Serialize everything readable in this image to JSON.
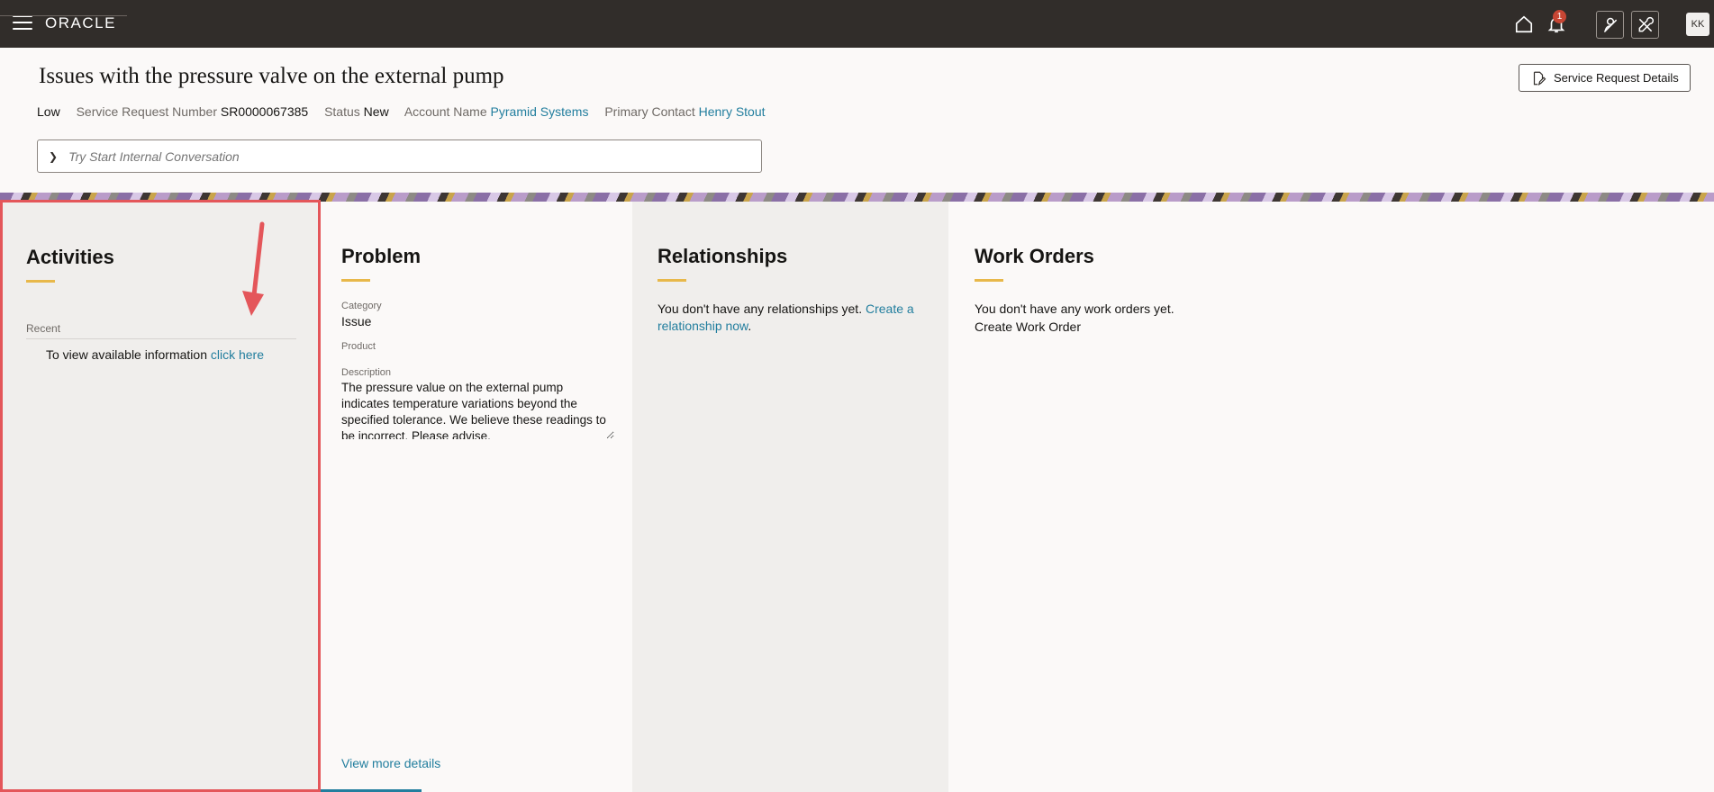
{
  "topbar": {
    "logo": "ORACLE",
    "notification_count": "1",
    "avatar_initials": "KK"
  },
  "header": {
    "title": "Issues with the pressure valve on the external pump",
    "details_button": "Service Request Details",
    "priority": "Low",
    "sr_number_label": "Service Request Number",
    "sr_number": "SR0000067385",
    "status_label": "Status",
    "status": "New",
    "account_label": "Account Name",
    "account": "Pyramid Systems",
    "contact_label": "Primary Contact",
    "contact": "Henry Stout",
    "conversation_placeholder": "Try Start Internal Conversation"
  },
  "activities": {
    "title": "Activities",
    "recent_label": "Recent",
    "message": "To view available information ",
    "link": "click here"
  },
  "problem": {
    "title": "Problem",
    "category_label": "Category",
    "category": "Issue",
    "product_label": "Product",
    "description_label": "Description",
    "description": "The pressure value on the external pump indicates temperature variations beyond the specified tolerance. We believe these readings to be incorrect. Please advise.",
    "view_more": "View more details"
  },
  "relationships": {
    "title": "Relationships",
    "empty": "You don't have any relationships yet. ",
    "link": "Create a relationship now",
    "suffix": "."
  },
  "work_orders": {
    "title": "Work Orders",
    "empty": "You don't have any work orders yet.",
    "link": "Create Work Order"
  },
  "colors": {
    "topbar": "#312d2a",
    "link": "#227e9e",
    "accent": "#e8b84a",
    "highlight": "#e4565a",
    "badge": "#c74634"
  }
}
